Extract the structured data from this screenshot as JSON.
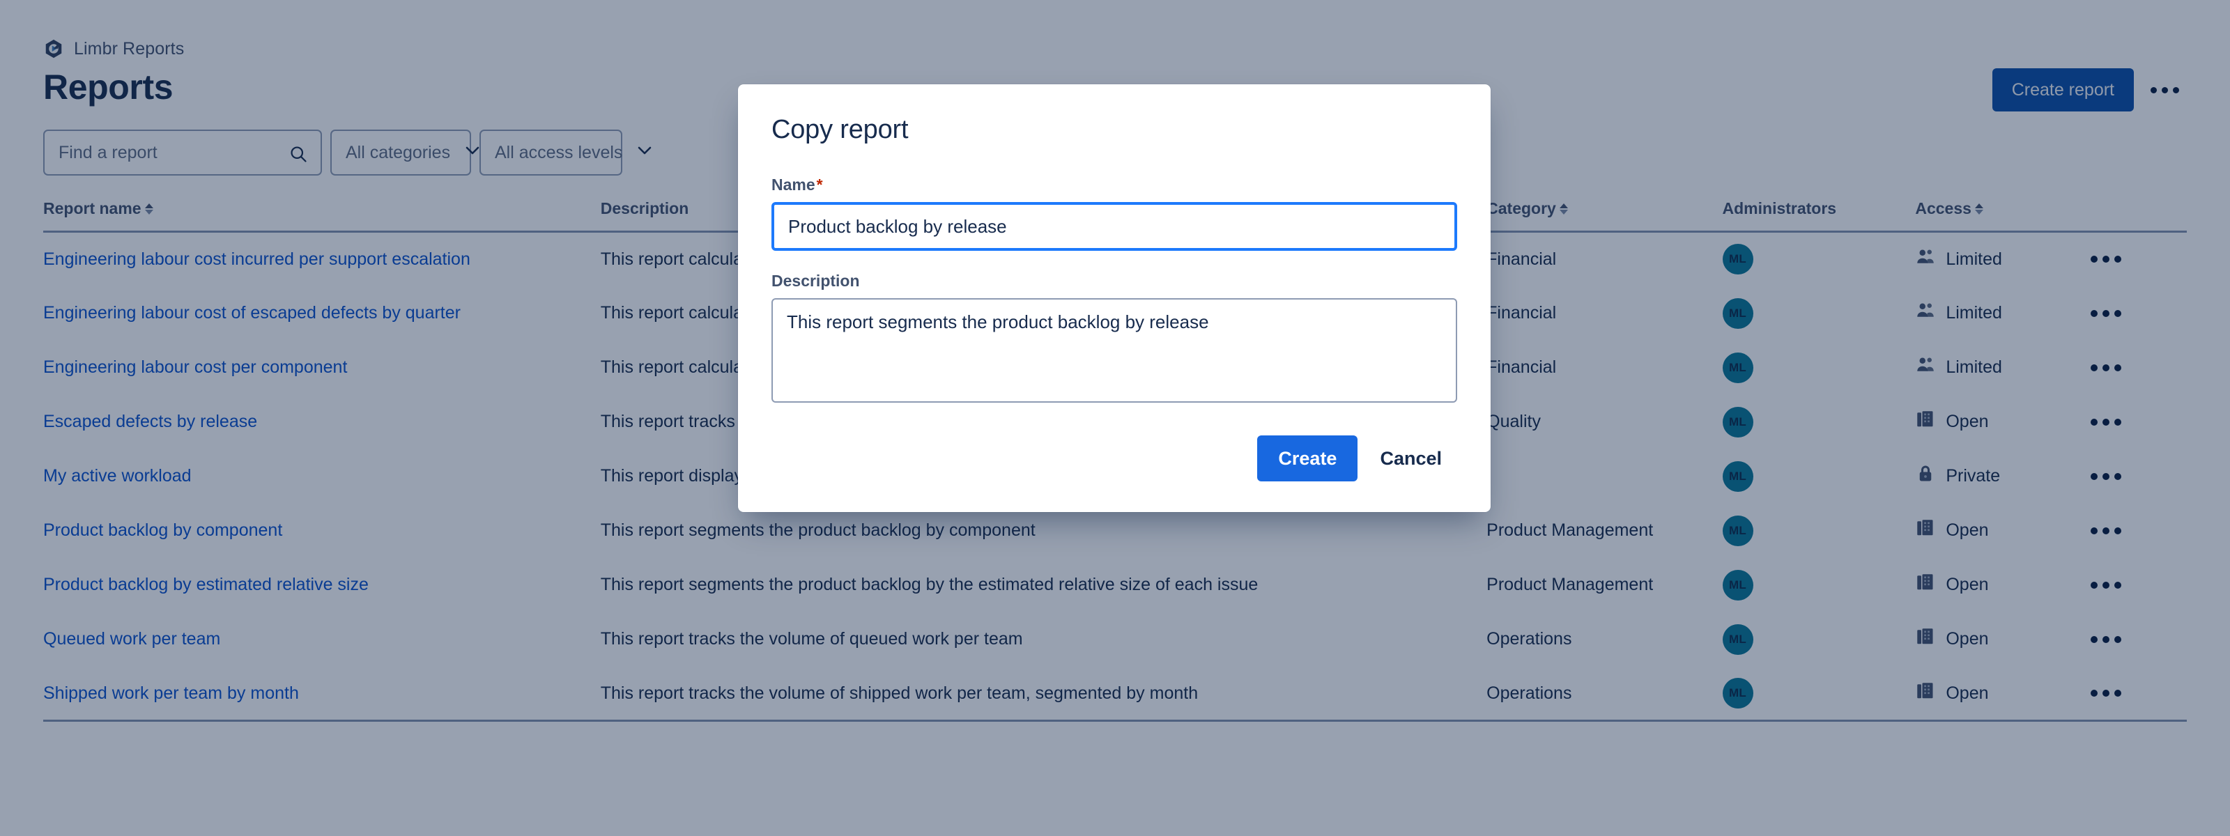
{
  "brand": {
    "name": "Limbr Reports",
    "logo_icon": "limbr-hexagon-logo"
  },
  "header": {
    "title": "Reports",
    "create_report_label": "Create report",
    "more_icon": "ellipsis-icon"
  },
  "toolbar": {
    "search_placeholder": "Find a report",
    "search_icon": "search-icon",
    "category_filter": "All categories",
    "access_filter": "All access levels",
    "chevron_icon": "chevron-down-icon"
  },
  "table": {
    "columns": [
      {
        "label": "Report name",
        "sortable": true
      },
      {
        "label": "Description",
        "sortable": false
      },
      {
        "label": "Category",
        "sortable": true
      },
      {
        "label": "Administrators",
        "sortable": false
      },
      {
        "label": "Access",
        "sortable": true
      }
    ],
    "rows": [
      {
        "name": "Engineering labour cost incurred per support escalation",
        "description": "This report calculates the engineering labour cost incurred per support escalation",
        "category": "Financial",
        "administrator": "ML",
        "access": "Limited",
        "access_icon": "people-icon"
      },
      {
        "name": "Engineering labour cost of escaped defects by quarter",
        "description": "This report calculates the engineering labour cost of escaped defects by quarter",
        "category": "Financial",
        "administrator": "ML",
        "access": "Limited",
        "access_icon": "people-icon"
      },
      {
        "name": "Engineering labour cost per component",
        "description": "This report calculates the engineering labour cost per component",
        "category": "Financial",
        "administrator": "ML",
        "access": "Limited",
        "access_icon": "people-icon"
      },
      {
        "name": "Escaped defects by release",
        "description": "This report tracks the escaped defects by release",
        "category": "Quality",
        "administrator": "ML",
        "access": "Open",
        "access_icon": "building-icon"
      },
      {
        "name": "My active workload",
        "description": "This report displays my active workload across all projects",
        "category": "",
        "administrator": "ML",
        "access": "Private",
        "access_icon": "lock-icon"
      },
      {
        "name": "Product backlog by component",
        "description": "This report segments the product backlog by component",
        "category": "Product Management",
        "administrator": "ML",
        "access": "Open",
        "access_icon": "building-icon"
      },
      {
        "name": "Product backlog by estimated relative size",
        "description": "This report segments the product backlog by the estimated relative size of each issue",
        "category": "Product Management",
        "administrator": "ML",
        "access": "Open",
        "access_icon": "building-icon"
      },
      {
        "name": "Queued work per team",
        "description": "This report tracks the volume of queued work per team",
        "category": "Operations",
        "administrator": "ML",
        "access": "Open",
        "access_icon": "building-icon"
      },
      {
        "name": "Shipped work per team by month",
        "description": "This report tracks the volume of shipped work per team, segmented by month",
        "category": "Operations",
        "administrator": "ML",
        "access": "Open",
        "access_icon": "building-icon"
      }
    ],
    "row_menu_icon": "ellipsis-icon"
  },
  "modal": {
    "title": "Copy report",
    "name_label": "Name",
    "name_required_marker": "*",
    "name_value": "Product backlog by release",
    "description_label": "Description",
    "description_value": "This report segments the product backlog by release",
    "create_label": "Create",
    "cancel_label": "Cancel"
  },
  "colors": {
    "primary_blue": "#0B4FA8",
    "create_blue": "#1868E0",
    "focus_blue": "#1D7AFC",
    "link_blue": "#0B52CC",
    "avatar_teal": "#0A7797",
    "required_red": "#BF2600",
    "text_dark": "#172B4D"
  }
}
